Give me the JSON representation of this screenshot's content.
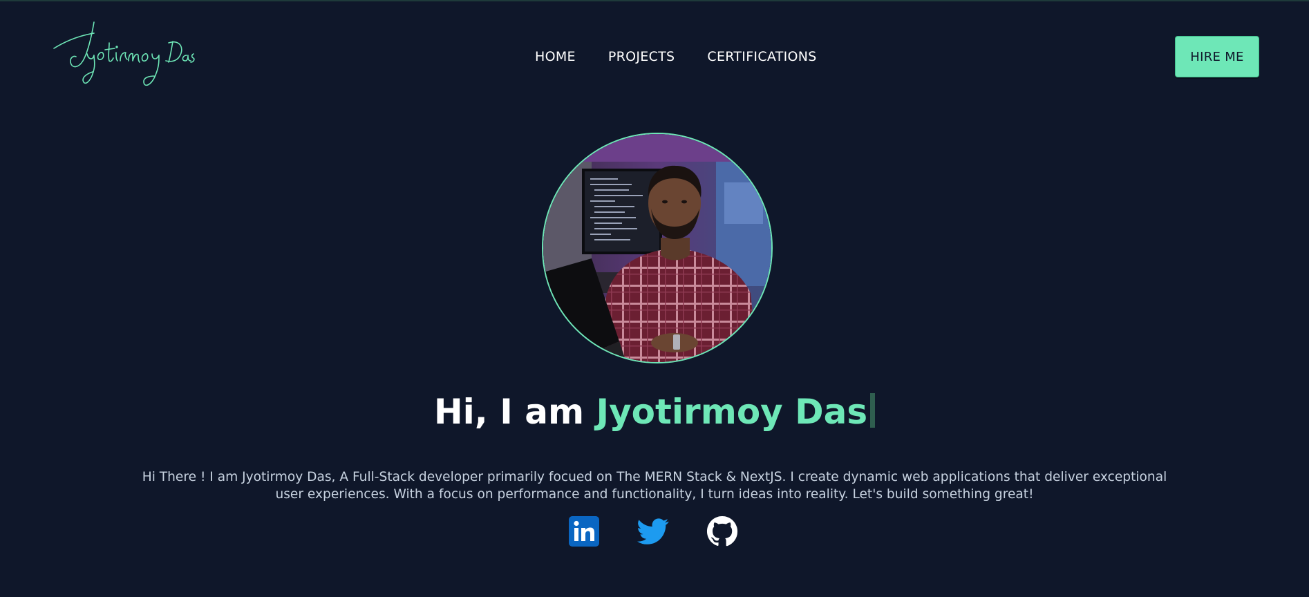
{
  "header": {
    "logo_text": "Jyotirmoy Das",
    "nav": [
      {
        "label": "HOME"
      },
      {
        "label": "PROJECTS"
      },
      {
        "label": "CERTIFICATIONS"
      }
    ],
    "cta_label": "HIRE ME"
  },
  "hero": {
    "greeting": "Hi, I am ",
    "name": "Jyotirmoy Das",
    "intro": "Hi There ! I am Jyotirmoy Das, A Full-Stack developer primarily focued on The MERN Stack & NextJS. I create dynamic web applications that deliver exceptional user experiences. With a focus on performance and functionality, I turn ideas into reality. Let's build something great!"
  },
  "socials": [
    {
      "icon": "linkedin-icon",
      "color": "#0a66c2"
    },
    {
      "icon": "twitter-icon",
      "color": "#1d9bf0"
    },
    {
      "icon": "github-icon",
      "color": "#ffffff"
    }
  ],
  "colors": {
    "background": "#0f172a",
    "accent": "#6ee7b7",
    "text": "#ffffff",
    "muted_text": "#c7d2e0"
  }
}
